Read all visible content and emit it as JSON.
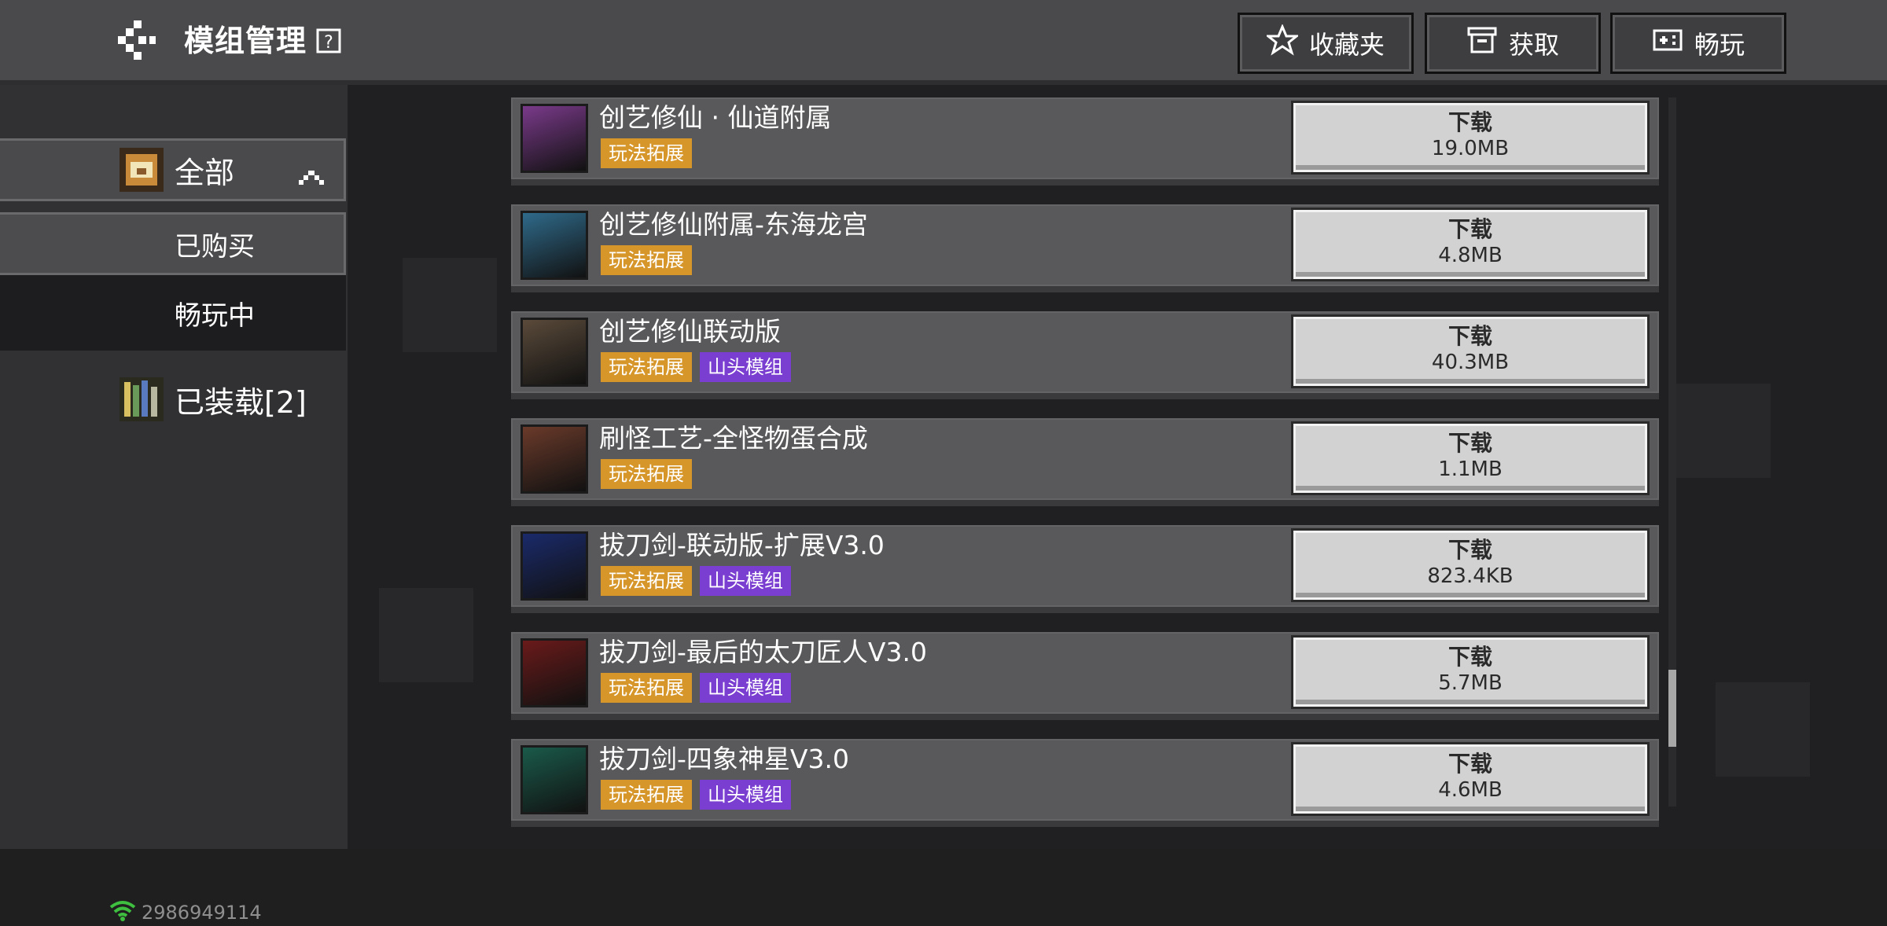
{
  "header": {
    "title": "模组管理",
    "buttons": [
      {
        "label": "收藏夹",
        "icon": "star-icon"
      },
      {
        "label": "获取",
        "icon": "box-icon"
      },
      {
        "label": "畅玩",
        "icon": "gamepad-icon"
      }
    ]
  },
  "sidebar": {
    "items": [
      {
        "label": "全部",
        "icon": "chest-icon",
        "selected": true
      },
      {
        "label": "已购买"
      },
      {
        "label": "畅玩中"
      },
      {
        "label": "已装载[2]",
        "icon": "bookshelf-icon"
      }
    ],
    "network_id": "2986949114"
  },
  "mods": [
    {
      "title": "创艺修仙 · 仙道附属",
      "tags": [
        "玩法拓展"
      ],
      "button": "下载",
      "size": "19.0MB",
      "thumb_color": "#7a3a8a"
    },
    {
      "title": "创艺修仙附属-东海龙宫",
      "tags": [
        "玩法拓展"
      ],
      "button": "下载",
      "size": "4.8MB",
      "thumb_color": "#2f6a8a"
    },
    {
      "title": "创艺修仙联动版",
      "tags": [
        "玩法拓展",
        "山头模组"
      ],
      "button": "下载",
      "size": "40.3MB",
      "thumb_color": "#5a4a3a"
    },
    {
      "title": "刷怪工艺-全怪物蛋合成",
      "tags": [
        "玩法拓展"
      ],
      "button": "下载",
      "size": "1.1MB",
      "thumb_color": "#6a3a2a"
    },
    {
      "title": "拔刀剑-联动版-扩展V3.0",
      "tags": [
        "玩法拓展",
        "山头模组"
      ],
      "button": "下载",
      "size": "823.4KB",
      "thumb_color": "#1a2a6a"
    },
    {
      "title": "拔刀剑-最后的太刀匠人V3.0",
      "tags": [
        "玩法拓展",
        "山头模组"
      ],
      "button": "下载",
      "size": "5.7MB",
      "thumb_color": "#6a1a1a"
    },
    {
      "title": "拔刀剑-四象神星V3.0",
      "tags": [
        "玩法拓展",
        "山头模组"
      ],
      "button": "下载",
      "size": "4.6MB",
      "thumb_color": "#1a5a4a"
    }
  ],
  "colors": {
    "tag_gameplay": "#d6962a",
    "tag_mountain": "#7a3ed1",
    "wifi": "#3fbf3f"
  }
}
